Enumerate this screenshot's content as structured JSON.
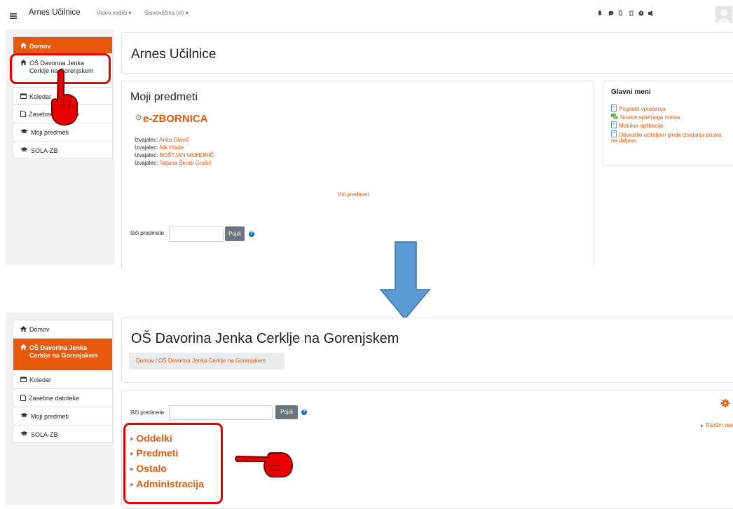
{
  "navbar": {
    "menu_icon": "hamburger-icon",
    "brand": "Arnes Učilnice",
    "video_guides": "Video vodiči",
    "language": "Slovenščina (sl)",
    "icons": [
      "bell-icon",
      "chat-icon",
      "book-icon",
      "box-icon",
      "help-icon",
      "megaphone-icon"
    ]
  },
  "top": {
    "sidebar": [
      {
        "label": "Domov",
        "icon": "home-icon"
      },
      {
        "label": "OŠ Davorina Jenka Cerklje na Gorenjskem",
        "icon": "home-icon"
      },
      {
        "label": "Koledar",
        "icon": "calendar-icon"
      },
      {
        "label": "Zasebne datoteke",
        "icon": "file-icon"
      },
      {
        "label": "Moji predmeti",
        "icon": "graduation-cap-icon"
      },
      {
        "label": "SOLA-ZB",
        "icon": "graduation-cap-icon"
      }
    ],
    "page_title": "Arnes Učilnice",
    "my_courses": {
      "heading": "Moji predmeti",
      "course_name": "e-ZBORNICA",
      "teacher_label": "Izvajalec:",
      "teachers": [
        "Anita Glavič",
        "Nik Hlade",
        "BOŠTJAN MOHORIČ",
        "Tatjana Škrab Grašič"
      ],
      "all_courses": "Vsi predmeti",
      "search_label": "Išči predmete",
      "search_button": "Pojdi"
    },
    "main_menu": {
      "heading": "Glavni meni",
      "items": [
        "Pogosta vprašanja",
        "Novice spletnega mesta",
        "Mobilna aplikacija",
        "Obvestilo učiteljem glede izvajanja pouka"
      ],
      "items_tail": "na daljavo"
    }
  },
  "bottom": {
    "sidebar": [
      {
        "label": "Domov",
        "icon": "home-icon"
      },
      {
        "label": "OŠ Davorina Jenka Cerklje na Gorenjskem",
        "icon": "home-icon"
      },
      {
        "label": "Koledar",
        "icon": "calendar-icon"
      },
      {
        "label": "Zasebne datoteke",
        "icon": "file-icon"
      },
      {
        "label": "Moji predmeti",
        "icon": "graduation-cap-icon"
      },
      {
        "label": "SOLA-ZB",
        "icon": "graduation-cap-icon"
      }
    ],
    "page_title": "OŠ Davorina Jenka Cerklje na Gorenjskem",
    "breadcrumb": [
      "Domov",
      "/",
      "OŠ Davorina Jenka Cerklje na Gorenjskem"
    ],
    "search_label": "Išči predmete",
    "search_button": "Pojdi",
    "expand_all": "Razširi vse",
    "categories": [
      "Oddelki",
      "Predmeti",
      "Ostalo",
      "Administracija"
    ]
  },
  "colors": {
    "accent": "#e8590c",
    "annotation": "#e60000",
    "arrow": "#5b9bd5"
  }
}
